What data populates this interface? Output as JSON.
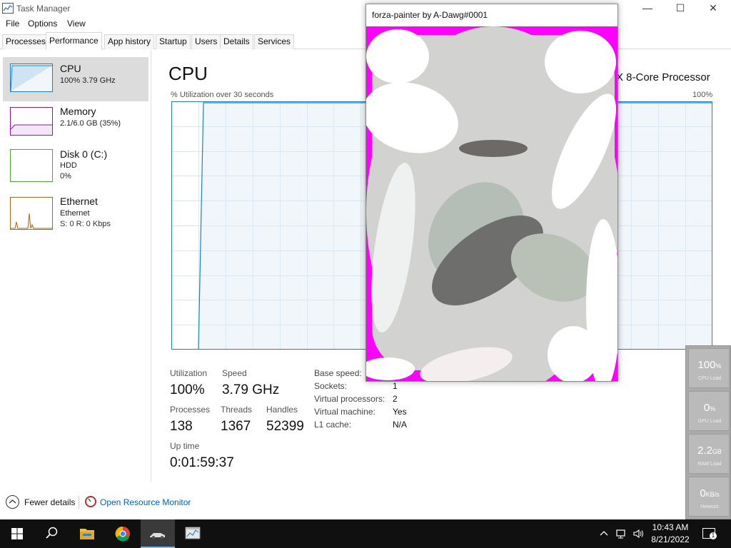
{
  "window": {
    "title": "Task Manager",
    "min": "—",
    "max": "☐",
    "close": "✕"
  },
  "menu": [
    "File",
    "Options",
    "View"
  ],
  "tabs": [
    "Processes",
    "Performance",
    "App history",
    "Startup",
    "Users",
    "Details",
    "Services"
  ],
  "active_tab": "Performance",
  "sidebar": {
    "items": [
      {
        "name": "CPU",
        "line1": "100%  3.79 GHz",
        "line2": "",
        "color": "#1f7fbf"
      },
      {
        "name": "Memory",
        "line1": "2.1/6.0 GB (35%)",
        "line2": "",
        "color": "#8b1a9c"
      },
      {
        "name": "Disk 0 (C:)",
        "line1": "HDD",
        "line2": "0%",
        "color": "#4da832"
      },
      {
        "name": "Ethernet",
        "line1": "Ethernet",
        "line2": "S: 0  R: 0 Kbps",
        "color": "#a66a1c"
      }
    ]
  },
  "main": {
    "title": "CPU",
    "processor": "X 8-Core Processor",
    "graph_caption": "% Utilization over 30 seconds",
    "graph_max": "100%",
    "stats": {
      "utilization_label": "Utilization",
      "utilization": "100%",
      "speed_label": "Speed",
      "speed": "3.79 GHz",
      "processes_label": "Processes",
      "processes": "138",
      "threads_label": "Threads",
      "threads": "1367",
      "handles_label": "Handles",
      "handles": "52399",
      "uptime_label": "Up time",
      "uptime": "0:01:59:37"
    },
    "info": [
      {
        "label": "Base speed:",
        "value": ""
      },
      {
        "label": "Sockets:",
        "value": "1"
      },
      {
        "label": "Virtual processors:",
        "value": "2"
      },
      {
        "label": "Virtual machine:",
        "value": "Yes"
      },
      {
        "label": "L1 cache:",
        "value": "N/A"
      }
    ]
  },
  "footer": {
    "fewer_details": "Fewer details",
    "resource_monitor": "Open Resource Monitor"
  },
  "painter": {
    "title": "forza-painter by A-Dawg#0001",
    "background": "#ff00ff"
  },
  "gadget": [
    {
      "value": "100",
      "unit": "%",
      "label": "CPU Load"
    },
    {
      "value": "0",
      "unit": "%",
      "label": "GPU Load"
    },
    {
      "value": "2.2",
      "unit": "GB",
      "label": "RAM Load"
    },
    {
      "value": "0",
      "unit": "KB/s",
      "label": "Network"
    }
  ],
  "taskbar": {
    "time": "10:43 AM",
    "date": "8/21/2022",
    "notifications": "1",
    "icons": [
      "windows-start-icon",
      "search-icon",
      "file-explorer-icon",
      "chrome-icon",
      "car-app-icon",
      "task-manager-icon"
    ]
  },
  "colors": {
    "cpu_accent": "#1f7fbf",
    "graph_fill": "#f1f6fa",
    "grid": "#d9e7f2",
    "taskbar": "#101010"
  }
}
